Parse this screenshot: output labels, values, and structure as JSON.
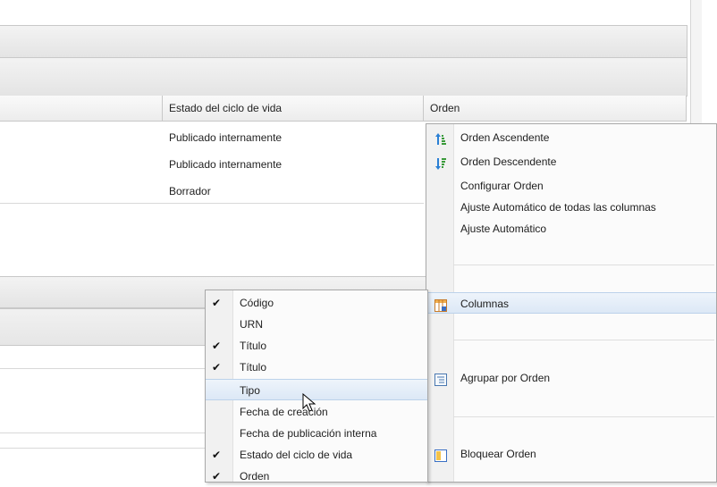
{
  "table": {
    "headers": [
      "Estado del ciclo de vida",
      "Orden"
    ],
    "rows": [
      [
        "Publicado internamente"
      ],
      [
        "Publicado internamente"
      ],
      [
        "Borrador"
      ]
    ]
  },
  "context_menu": {
    "items": [
      {
        "label": "Orden Ascendente",
        "icon": "sort-ascending-icon"
      },
      {
        "label": "Orden Descendente",
        "icon": "sort-descending-icon"
      },
      {
        "label": "Configurar Orden",
        "icon": ""
      },
      {
        "label": "Ajuste Automático de todas las columnas",
        "icon": ""
      },
      {
        "label": "Ajuste Automático",
        "icon": ""
      },
      {
        "label": "Columnas",
        "icon": "columns-icon"
      },
      {
        "label": "Agrupar por Orden",
        "icon": "group-icon"
      },
      {
        "label": "Bloquear Orden",
        "icon": "freeze-icon"
      }
    ]
  },
  "columns_submenu": {
    "items": [
      {
        "label": "Código",
        "checked": true
      },
      {
        "label": "URN",
        "checked": false
      },
      {
        "label": "Título",
        "checked": true
      },
      {
        "label": "Título",
        "checked": true
      },
      {
        "label": "Tipo",
        "checked": false
      },
      {
        "label": "Fecha de creación",
        "checked": false
      },
      {
        "label": "Fecha de publicación interna",
        "checked": false
      },
      {
        "label": "Estado del ciclo de vida",
        "checked": true
      },
      {
        "label": "Orden",
        "checked": true
      }
    ]
  },
  "colors": {
    "highlight": "#dce8f6",
    "border": "#a8a8a8"
  }
}
